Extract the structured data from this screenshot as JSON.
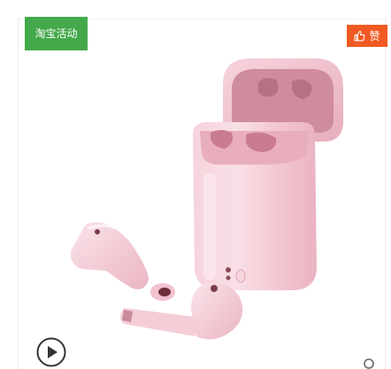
{
  "tag": {
    "label": "淘宝活动",
    "color": "#44a94a"
  },
  "like": {
    "label": "赞",
    "icon": "thumbs-up-icon",
    "color": "#f05a22"
  },
  "product": {
    "kind": "pink wireless earbuds with charging case"
  },
  "controls": {
    "play_icon": "play-icon",
    "zoom_icon": "magnifier-icon"
  }
}
